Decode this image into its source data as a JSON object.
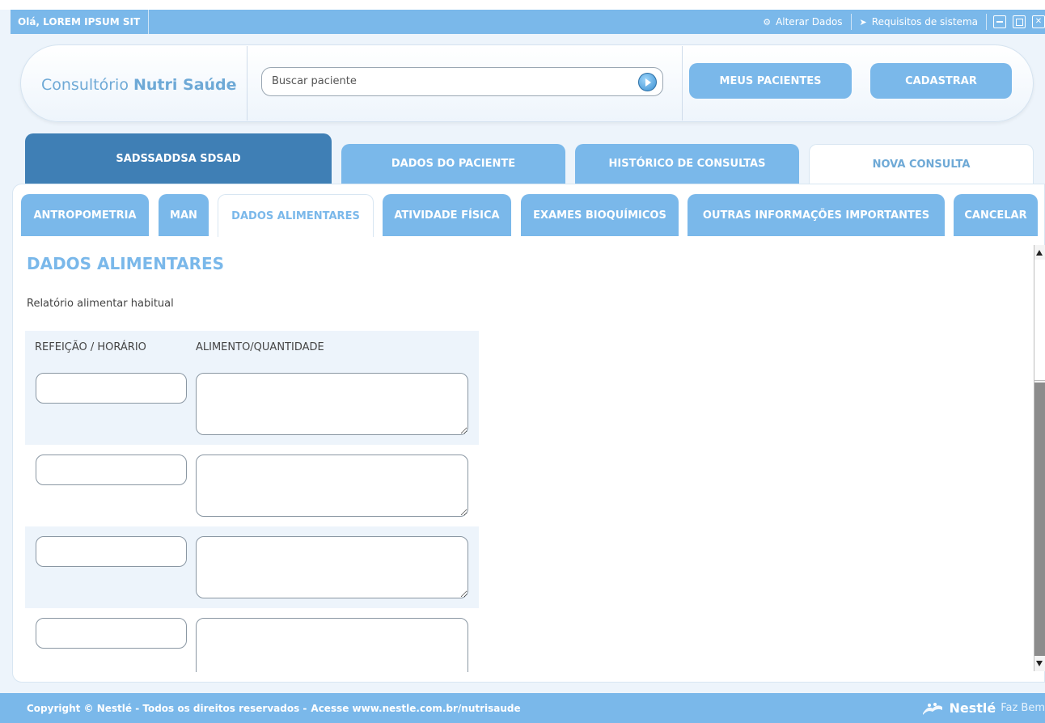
{
  "topbar": {
    "greeting": "Olá, LOREM IPSUM SIT",
    "alterar": "Alterar Dados",
    "requisitos": "Requisitos de sistema"
  },
  "header": {
    "brand_prefix": "Consultório",
    "brand_name": "Nutri Saúde",
    "search_placeholder": "Buscar paciente",
    "meus_pacientes": "MEUS PACIENTES",
    "cadastrar": "CADASTRAR"
  },
  "patient_tabs": {
    "patient": "SADSSADDSA SDSAD",
    "dados": "DADOS DO PACIENTE",
    "historico": "HISTÓRICO DE CONSULTAS",
    "nova": "NOVA CONSULTA"
  },
  "section_tabs": [
    "ANTROPOMETRIA",
    "MAN",
    "DADOS ALIMENTARES",
    "ATIVIDADE FÍSICA",
    "EXAMES BIOQUÍMICOS",
    "OUTRAS INFORMAÇÕES IMPORTANTES",
    "CANCELAR"
  ],
  "content": {
    "title": "DADOS ALIMENTARES",
    "subtitle": "Relatório alimentar habitual",
    "col_meal": "REFEIÇÃO / HORÁRIO",
    "col_food": "ALIMENTO/QUANTIDADE"
  },
  "footer": {
    "copyright": "Copyright © Nestlé - Todos os direitos reservados -",
    "site": "Acesse www.nestle.com.br/nutrisaude",
    "logo": "Nestlé",
    "slogan": "Faz Bem"
  },
  "colors": {
    "accent": "#7ab8ea",
    "patient_tab": "#3f7fb5"
  }
}
